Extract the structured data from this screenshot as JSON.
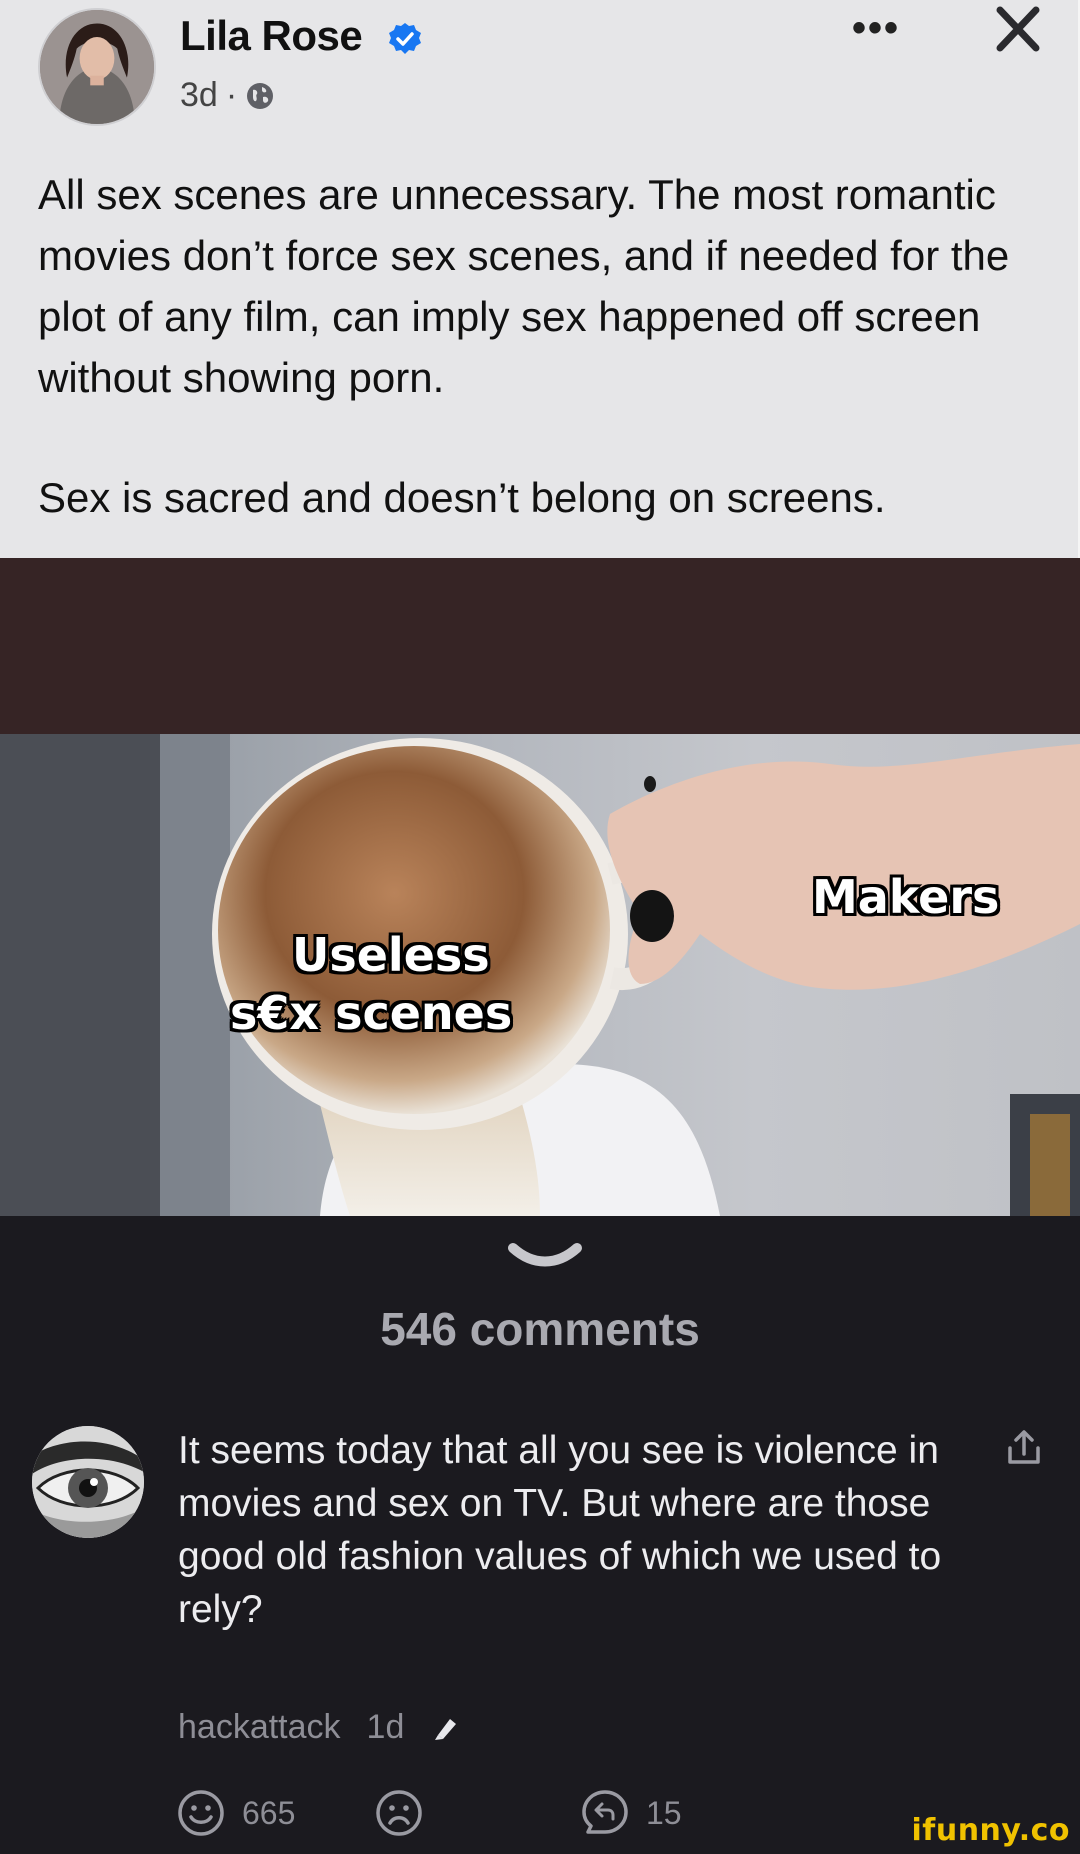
{
  "post": {
    "author_name": "Lila Rose",
    "time": "3d",
    "separator": "·",
    "more_label": "•••",
    "paragraphs": [
      "All sex scenes are unnecessary. The most romantic movies don’t force sex scenes, and if needed for the plot of any film, can imply sex happened off screen without showing porn.",
      "Sex is sacred and doesn’t belong on screens."
    ]
  },
  "meme": {
    "label_makers": "Makers",
    "label_useless": "Useless",
    "label_scenes": "s€x scenes"
  },
  "comments": {
    "count_label": "546 comments",
    "items": [
      {
        "text": "It seems today that all you see is violence in movies and sex on TV. But where are those good old fashion values of which we used to rely?",
        "username": "hackattack",
        "time": "1d",
        "smile_count": "665",
        "reply_count": "15"
      }
    ]
  },
  "watermark": "ifunny.co",
  "colors": {
    "card_bg": "#e6e6e8",
    "panel_bg": "#1b1a1f",
    "verified_blue": "#1877f2",
    "watermark_yellow": "#f0c200"
  }
}
